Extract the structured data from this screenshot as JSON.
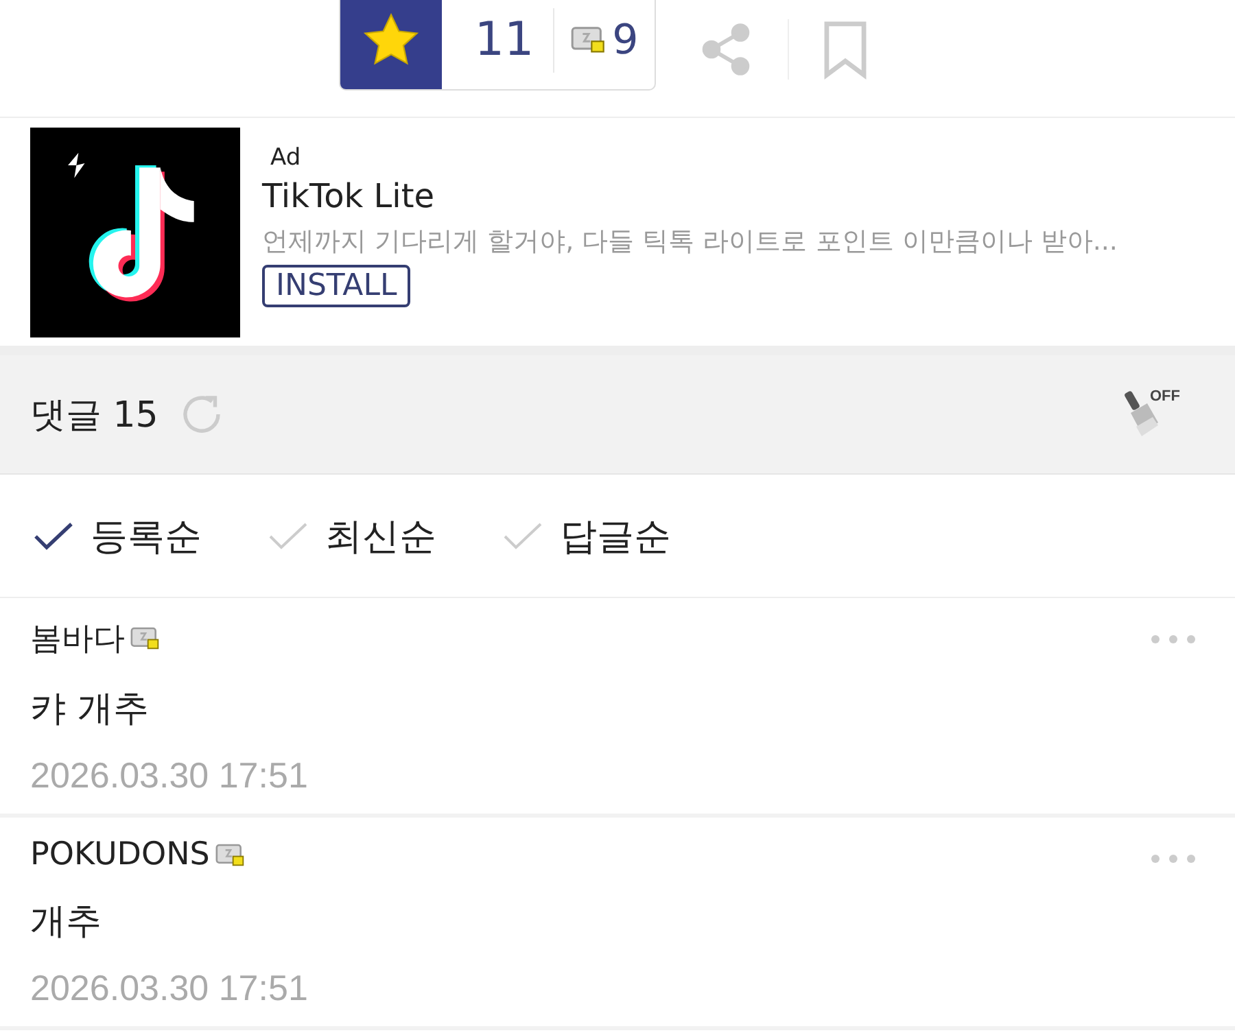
{
  "vote_bar": {
    "starred": true,
    "count": "11",
    "level_count": "9"
  },
  "ad": {
    "label": "Ad",
    "title": "TikTok Lite",
    "description": "언제까지 기다리게 할거야, 다들 틱톡 라이트로 포인트 이만큼이나 받아...",
    "button": "INSTALL"
  },
  "comments_header": {
    "title": "댓글 15",
    "filter_badge": "OFF"
  },
  "sort_options": [
    {
      "label": "등록순",
      "selected": true
    },
    {
      "label": "최신순",
      "selected": false
    },
    {
      "label": "답글순",
      "selected": false
    }
  ],
  "comments": [
    {
      "author": "봄바다",
      "text": "캬 개추",
      "date": "2026.03.30 17:51"
    },
    {
      "author": "POKUDONS",
      "text": "개추",
      "date": "2026.03.30 17:51"
    }
  ]
}
